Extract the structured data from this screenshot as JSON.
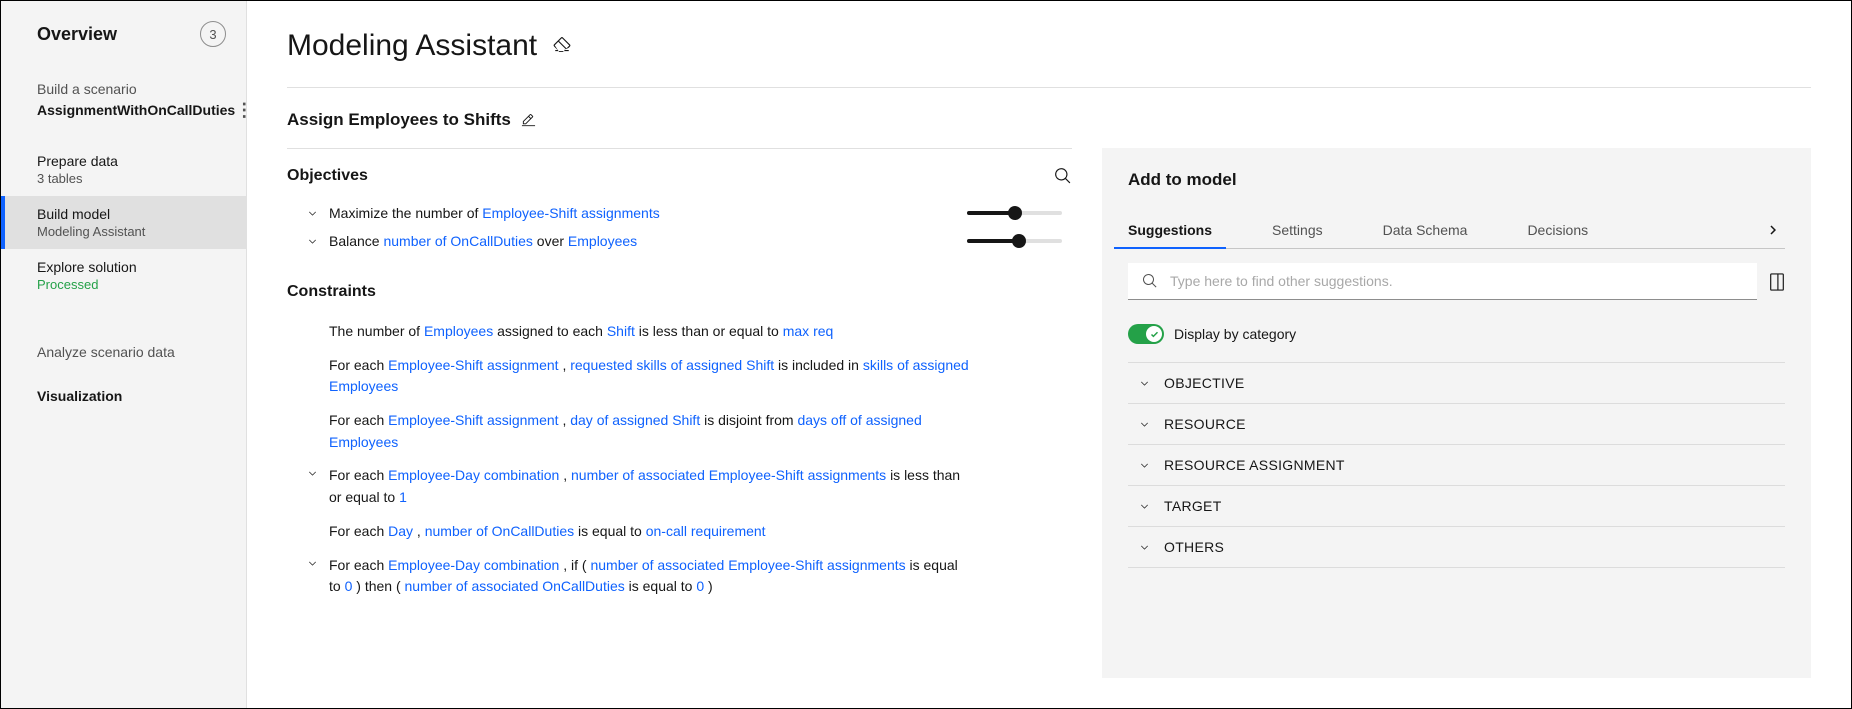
{
  "sidebar": {
    "overview_label": "Overview",
    "badge_count": "3",
    "build_scenario_label": "Build a scenario",
    "scenario_name": "AssignmentWithOnCallDuties",
    "items": [
      {
        "title": "Prepare data",
        "sub": "3 tables"
      },
      {
        "title": "Build model",
        "sub": "Modeling Assistant"
      },
      {
        "title": "Explore solution",
        "sub": "Processed"
      }
    ],
    "analyze_label": "Analyze scenario data",
    "visualization_label": "Visualization"
  },
  "page": {
    "title": "Modeling Assistant",
    "subtitle": "Assign Employees to Shifts"
  },
  "objectives": {
    "heading": "Objectives",
    "rows": [
      {
        "pre": "Maximize the number of ",
        "link": "Employee-Shift assignments",
        "slider": 0.5
      },
      {
        "pre": "Balance ",
        "link1": "number of OnCallDuties",
        "mid": " over ",
        "link2": "Employees",
        "slider": 0.55
      }
    ]
  },
  "constraints": {
    "heading": "Constraints",
    "rows": [
      {
        "parts": [
          "The number of ",
          {
            "l": "Employees"
          },
          " assigned to each ",
          {
            "l": "Shift "
          },
          " is less than or equal to ",
          {
            "l": " max req"
          }
        ],
        "chev": false
      },
      {
        "parts": [
          "For each ",
          {
            "l": "Employee-Shift assignment"
          },
          " , ",
          {
            "l": "requested skills of assigned Shift "
          },
          " is included in ",
          {
            "l": "skills of assigned Employees"
          }
        ],
        "chev": false
      },
      {
        "parts": [
          "For each ",
          {
            "l": "Employee-Shift assignment"
          },
          " , ",
          {
            "l": "day of assigned Shift "
          },
          " is disjoint from ",
          {
            "l": "days off of assigned Employees"
          }
        ],
        "chev": false
      },
      {
        "parts": [
          "For each ",
          {
            "l": "Employee-Day combination"
          },
          " , ",
          {
            "l": "number of associated Employee-Shift assignments "
          },
          "is less than or equal to ",
          {
            "l": " 1"
          }
        ],
        "chev": true
      },
      {
        "parts": [
          "For each ",
          {
            "l": "Day"
          },
          " , ",
          {
            "l": "number of OnCallDuties "
          },
          " is equal to ",
          {
            "l": " on-call requirement"
          }
        ],
        "chev": false
      },
      {
        "parts": [
          "For each ",
          {
            "l": "Employee-Day combination"
          },
          " , if ( ",
          {
            "l": "number of associated Employee-Shift assignments "
          },
          " is equal to ",
          {
            "l": " 0"
          },
          " ) then ( ",
          {
            "l": "number of associated OnCallDuties "
          },
          " is equal to ",
          {
            "l": " 0"
          },
          " )"
        ],
        "chev": true
      }
    ]
  },
  "right": {
    "title": "Add to model",
    "tabs": [
      "Suggestions",
      "Settings",
      "Data Schema",
      "Decisions"
    ],
    "active_tab": 0,
    "search_placeholder": "Type here to find other suggestions.",
    "toggle_label": "Display by category",
    "toggle_on": true,
    "categories": [
      "OBJECTIVE",
      "RESOURCE",
      "RESOURCE ASSIGNMENT",
      "TARGET",
      "OTHERS"
    ]
  }
}
